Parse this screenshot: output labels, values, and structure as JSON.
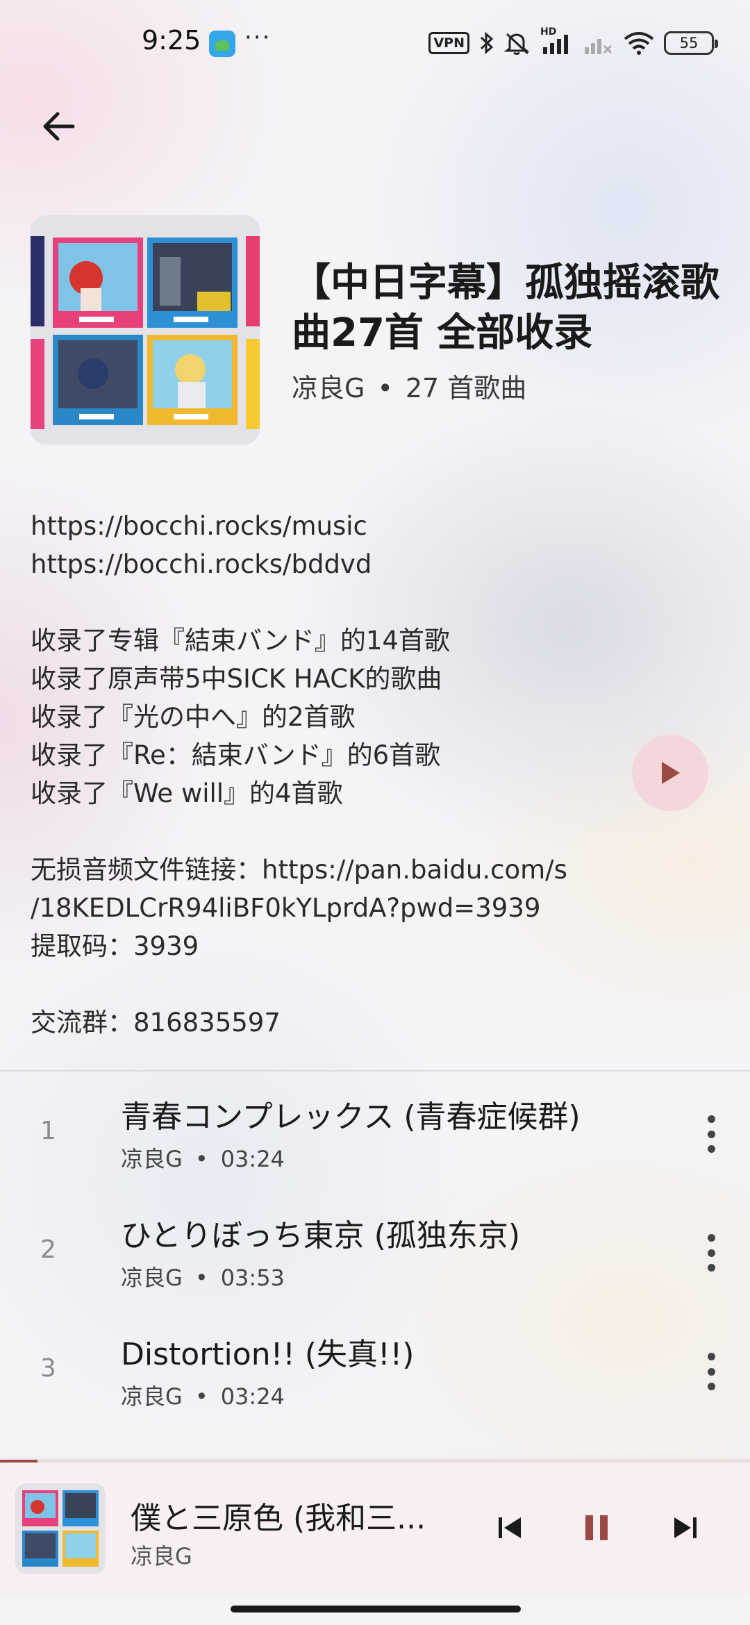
{
  "status_bar": {
    "time": "9:25",
    "more": "···",
    "vpn": "VPN",
    "hd": "HD",
    "battery": "55",
    "icons": [
      "app-icon",
      "bluetooth-icon",
      "mute-icon",
      "signal-icon",
      "signal-2-icon",
      "wifi-icon",
      "battery-icon"
    ]
  },
  "header": {
    "back_icon": "arrow-left-icon"
  },
  "playlist": {
    "title": "【中日字幕】孤独摇滚歌曲27首 全部收录",
    "author": "凉良G",
    "separator": "•",
    "count": "27 首歌曲",
    "description": [
      "https://bocchi.rocks/music",
      "https://bocchi.rocks/bddvd",
      "",
      "收录了专辑『結束バンド』的14首歌",
      "收录了原声带5中SICK HACK的歌曲",
      "收录了『光の中へ』的2首歌",
      "收录了『Re：結束バンド』的6首歌",
      "收录了『We will』的4首歌",
      "",
      "无损音频文件链接：https://pan.baidu.com/s",
      "/18KEDLCrR94liBF0kYLprdA?pwd=3939",
      "提取码：3939",
      "",
      "交流群：816835597"
    ],
    "play_icon": "play-icon"
  },
  "tracks": [
    {
      "num": "1",
      "title": "青春コンプレックス (青春症候群)",
      "artist": "凉良G",
      "sep": "•",
      "duration": "03:24"
    },
    {
      "num": "2",
      "title": "ひとりぼっち東京 (孤独东京)",
      "artist": "凉良G",
      "sep": "•",
      "duration": "03:53"
    },
    {
      "num": "3",
      "title": "Distortion!! (失真!!)",
      "artist": "凉良G",
      "sep": "•",
      "duration": "03:24"
    }
  ],
  "mini_player": {
    "title": "僕と三原色 (我和三...",
    "artist": "凉良G",
    "progress": 0.05,
    "icons": [
      "skip-previous-icon",
      "pause-icon",
      "skip-next-icon"
    ],
    "accent": "#9a4a44"
  },
  "colors": {
    "fab_bg": "#f3d7da",
    "fab_icon": "#9a4a44"
  }
}
